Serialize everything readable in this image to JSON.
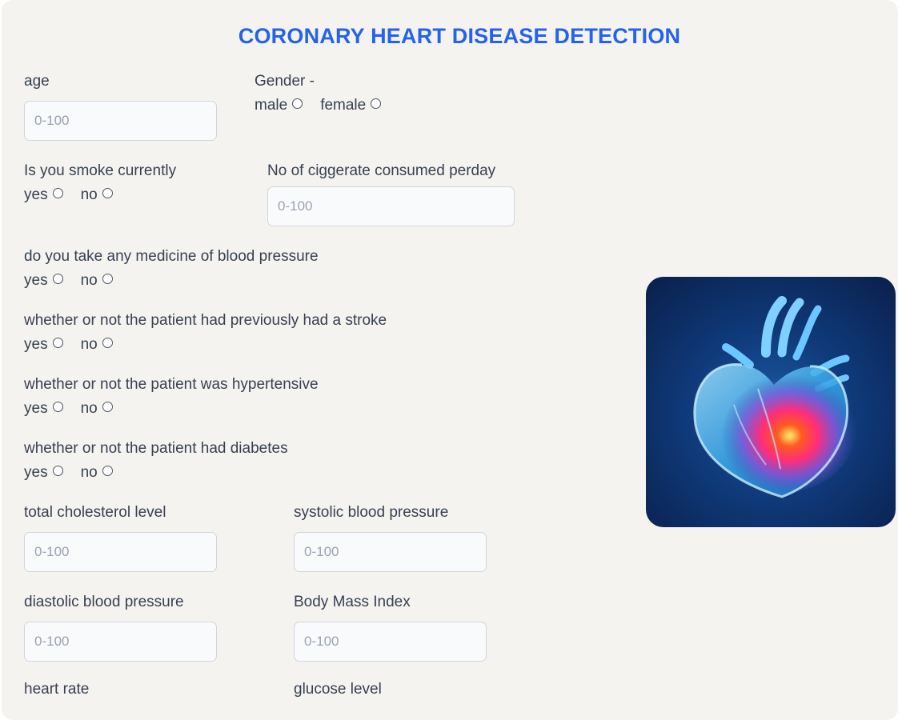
{
  "title": "CORONARY HEART DISEASE DETECTION",
  "form": {
    "age": {
      "label": "age",
      "placeholder": "0-100"
    },
    "gender": {
      "label": "Gender -",
      "options": [
        "male",
        "female"
      ]
    },
    "smoke": {
      "label": "Is you smoke currently",
      "options": [
        "yes",
        "no"
      ]
    },
    "cigs": {
      "label": "No of ciggerate consumed perday",
      "placeholder": "0-100"
    },
    "bp_meds": {
      "label": "do you take any medicine of blood pressure",
      "options": [
        "yes",
        "no"
      ]
    },
    "stroke": {
      "label": "whether or not the patient had previously had a stroke",
      "options": [
        "yes",
        "no"
      ]
    },
    "hypertensive": {
      "label": "whether or not the patient was hypertensive",
      "options": [
        "yes",
        "no"
      ]
    },
    "diabetes": {
      "label": "whether or not the patient had diabetes",
      "options": [
        "yes",
        "no"
      ]
    },
    "cholesterol": {
      "label": "total cholesterol level",
      "placeholder": "0-100"
    },
    "sys_bp": {
      "label": "systolic blood pressure",
      "placeholder": "0-100"
    },
    "dia_bp": {
      "label": "diastolic blood pressure",
      "placeholder": "0-100"
    },
    "bmi": {
      "label": "Body Mass Index",
      "placeholder": "0-100"
    },
    "heart_rate": {
      "label": "heart rate"
    },
    "glucose": {
      "label": "glucose level"
    }
  },
  "image": {
    "icon": "heart-illustration"
  }
}
